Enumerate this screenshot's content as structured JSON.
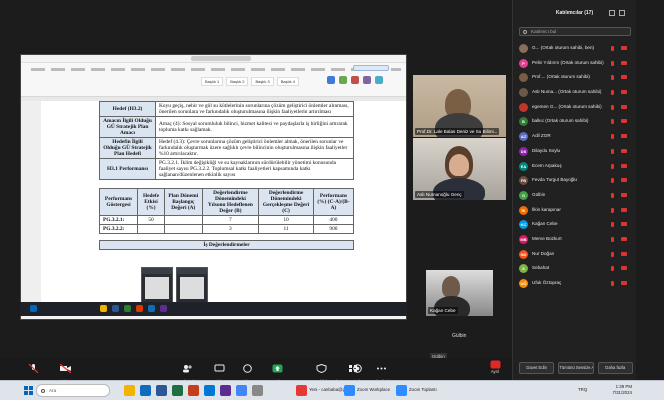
{
  "share": {
    "ribbon_styles": [
      "Başlık 1",
      "Başlık 2",
      "Başlık 3",
      "Başlık 4"
    ],
    "doc_rows": [
      {
        "label": "Hedef (H3.2)",
        "text": "Koyu geçiş, nehir ve göl su kütlelerinin sorunlarına çözüm geliştirici önlemler alınması, önerilen sorunlara ve farkındalık oluşturulmasına ilişkin faaliyetlerin artırılması"
      },
      {
        "label": "Amacın İlgili Olduğu GÜ Stratejik Plan Amacı",
        "text": "Amaç (4): Sosyal sorumluluk bilinci, hizmet kalitesi ve paydaşlarla iş birliğini artırarak topluma katkı sağlamak."
      },
      {
        "label": "Hedefin İlgili Olduğu GÜ Stratejik Plan Hedefi",
        "text": "Hedef (4.3): Çevre sorunlarına çözüm geliştirici önlemler almak, önerilen sorunlar ve farkındalık oluşturmak üzere sağlıklı çevre bilincinin oluşturulmasına ilişkin faaliyetler %10 artırılacaktır."
      },
      {
        "label": "H3.1 Performansı",
        "text": "PG.3.2.1. İklim değişikliği ve su kaynaklarının sürdürülebilir yönetimi konusunda faaliyet sayısı PG.3.2.2. Toplumsal katkı faaliyetleri kapsamında katkı sağlanan/düzenlenen etkinlik sayısı"
      }
    ],
    "perf_headers": [
      "Performans Göstergesi",
      "Hedefe Etkisi (%)",
      "Plan Dönemi Başlangıç Değeri (A)",
      "Değerlendirme Dönemindeki Yılsonu Hedeflenen Değer (B)",
      "Değerlendirme Dönemindeki Gerçekleşme Değeri (C)",
      "Performans (%) (C-A)/(B-A)"
    ],
    "perf_rows": [
      [
        "PG.3.2.1:",
        "50",
        "",
        "7",
        "10",
        "400"
      ],
      [
        "PG.3.2.2:",
        "",
        "",
        "3",
        "11",
        "900"
      ]
    ],
    "footer_text": "İş Değerlendirmeler"
  },
  "videos": {
    "v1_name": "Prof.Dr. Lale Balas Deniz ve Su Bilimi...",
    "v2_name": "Aslı Numanoğlu Genç",
    "v3_name": "Kağan Cebe",
    "gulbin_name": "Gülbin",
    "gulbin_tag": "Gülbin"
  },
  "panel": {
    "title": "Katılımcılar (17)",
    "search_placeholder": "Katılımcı bul",
    "participants": [
      {
        "name": "G... (Ortak oturum sahibi, ben)",
        "color": "#8a6d5a",
        "init": ""
      },
      {
        "name": "Pelin Yıldırım (Ortak oturum sahibi)",
        "color": "#e23f8f",
        "init": "P"
      },
      {
        "name": "Prof.... (Ortak oturum sahibi)",
        "color": "#7a5c44",
        "init": ""
      },
      {
        "name": "Aslı Numa... (Ortak oturum sahibi)",
        "color": "#6b5a4a",
        "init": ""
      },
      {
        "name": "egemen G... (Ortak oturum sahibi)",
        "color": "#c0362c",
        "init": ""
      },
      {
        "name": "balkıc (Ortak oturum sahibi)",
        "color": "#2e7d32",
        "init": "B"
      },
      {
        "name": "Adil ZOR",
        "color": "#5c6bc0",
        "init": "AZ"
      },
      {
        "name": "Dilaydu Soylu",
        "color": "#8e24aa",
        "init": "DS"
      },
      {
        "name": "Ecem Arpakuş",
        "color": "#00897b",
        "init": "EA"
      },
      {
        "name": "Fevda Turgut Bayoğlu",
        "color": "#6d4c41",
        "init": "FB"
      },
      {
        "name": "Gülbin",
        "color": "#43a047",
        "init": "G"
      },
      {
        "name": "İlkin karapınar",
        "color": "#ef6c00",
        "init": "İK"
      },
      {
        "name": "Kağan Cebe",
        "color": "#039be5",
        "init": "KC"
      },
      {
        "name": "Merve Bozkurt",
        "color": "#d81b60",
        "init": "MB"
      },
      {
        "name": "Nur Doğan",
        "color": "#f4511e",
        "init": "ND"
      },
      {
        "name": "Sebahat",
        "color": "#7cb342",
        "init": "S"
      },
      {
        "name": "Ufuk Öztopraç",
        "color": "#fb8c00",
        "init": "UÖ"
      }
    ],
    "btn_invite": "Davet Edin",
    "btn_mute_all": "Tümünü Sessize Al",
    "btn_more": "Daha fazla"
  },
  "toolbar": {
    "audio": "Ses",
    "video": "Video",
    "participants": "Katılımcılar",
    "participants_count": "17",
    "chat": "Sohbet",
    "react": "Tepki ver",
    "share": "Paylaş",
    "host": "Oturum sahibi araçları",
    "apps": "",
    "record": "Kaydet",
    "more": "Daha fazla",
    "end": "Ayrıl"
  },
  "taskbar": {
    "search_label": "Ara",
    "apps": [
      "Yeni - canbaba@g...",
      "Zoom Workplace",
      "Zoom Toplantı"
    ],
    "time": "1:39 PM",
    "date": "7/31/2024",
    "lang": "TRQ"
  }
}
